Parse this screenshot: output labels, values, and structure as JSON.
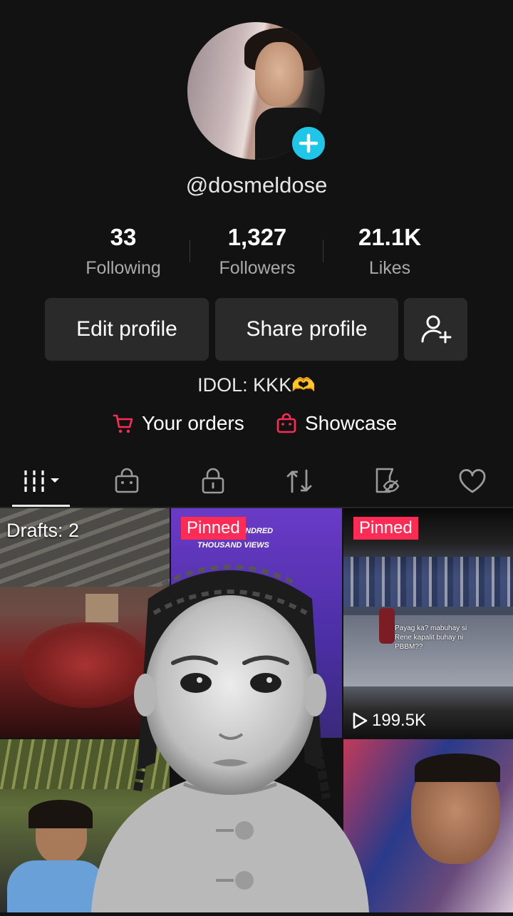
{
  "profile": {
    "username": "@dosmeldose",
    "bio": "IDOL: KKK🫶"
  },
  "stats": {
    "following": {
      "value": "33",
      "label": "Following"
    },
    "followers": {
      "value": "1,327",
      "label": "Followers"
    },
    "likes": {
      "value": "21.1K",
      "label": "Likes"
    }
  },
  "actions": {
    "edit_label": "Edit profile",
    "share_label": "Share profile"
  },
  "links": {
    "orders_label": "Your orders",
    "showcase_label": "Showcase"
  },
  "grid": {
    "drafts_label": "Drafts: 2",
    "pinned_label": "Pinned",
    "video2_overlay_line1": "NDRED",
    "video2_overlay_line2": "THOUSAND VIEWS",
    "video3_caption": "Payag ka? mabuhay si Rene kapalit buhay ni PBBM??",
    "video3_views": "199.5K"
  },
  "colors": {
    "accent_pink": "#fe2c55",
    "accent_cyan": "#20c6e8",
    "background": "#121212",
    "button_bg": "#2a2a2a"
  }
}
